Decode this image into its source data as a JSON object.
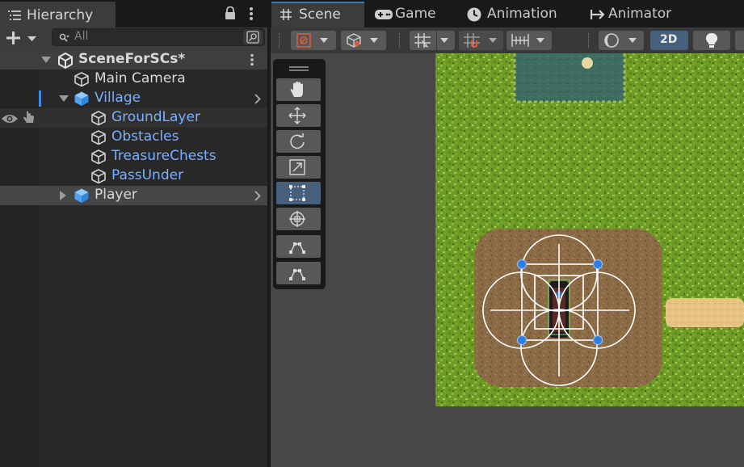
{
  "hierarchy": {
    "tab_label": "Hierarchy",
    "search_placeholder": "All",
    "scene_name": "SceneForSCs*",
    "items": [
      {
        "label": "Main Camera"
      },
      {
        "label": "Village"
      },
      {
        "label": "GroundLayer"
      },
      {
        "label": "Obstacles"
      },
      {
        "label": "TreasureChests"
      },
      {
        "label": "PassUnder"
      },
      {
        "label": "Player"
      }
    ]
  },
  "tabs": [
    {
      "label": "Scene"
    },
    {
      "label": "Game"
    },
    {
      "label": "Animation"
    },
    {
      "label": "Animator"
    }
  ],
  "scene_toolbar": {
    "mode_2d_label": "2D"
  },
  "colors": {
    "accent_blue": "#7ab0ff",
    "selected_tool": "#46607c",
    "grass": "#6f9a25",
    "dirt": "#8a6a45",
    "water": "#3e6a5e",
    "path": "#e7c487"
  }
}
